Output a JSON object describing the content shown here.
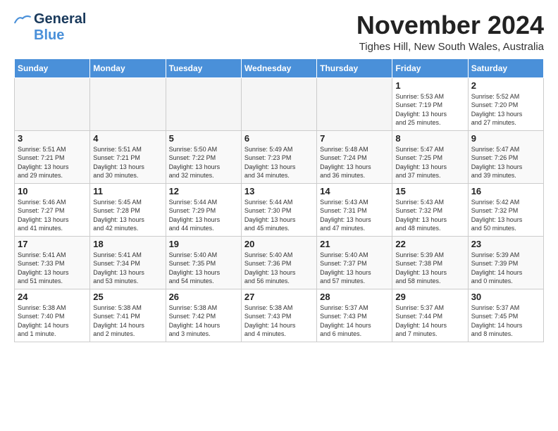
{
  "logo": {
    "line1": "General",
    "line2": "Blue"
  },
  "title": "November 2024",
  "location": "Tighes Hill, New South Wales, Australia",
  "days_of_week": [
    "Sunday",
    "Monday",
    "Tuesday",
    "Wednesday",
    "Thursday",
    "Friday",
    "Saturday"
  ],
  "weeks": [
    [
      {
        "day": "",
        "info": ""
      },
      {
        "day": "",
        "info": ""
      },
      {
        "day": "",
        "info": ""
      },
      {
        "day": "",
        "info": ""
      },
      {
        "day": "",
        "info": ""
      },
      {
        "day": "1",
        "info": "Sunrise: 5:53 AM\nSunset: 7:19 PM\nDaylight: 13 hours\nand 25 minutes."
      },
      {
        "day": "2",
        "info": "Sunrise: 5:52 AM\nSunset: 7:20 PM\nDaylight: 13 hours\nand 27 minutes."
      }
    ],
    [
      {
        "day": "3",
        "info": "Sunrise: 5:51 AM\nSunset: 7:21 PM\nDaylight: 13 hours\nand 29 minutes."
      },
      {
        "day": "4",
        "info": "Sunrise: 5:51 AM\nSunset: 7:21 PM\nDaylight: 13 hours\nand 30 minutes."
      },
      {
        "day": "5",
        "info": "Sunrise: 5:50 AM\nSunset: 7:22 PM\nDaylight: 13 hours\nand 32 minutes."
      },
      {
        "day": "6",
        "info": "Sunrise: 5:49 AM\nSunset: 7:23 PM\nDaylight: 13 hours\nand 34 minutes."
      },
      {
        "day": "7",
        "info": "Sunrise: 5:48 AM\nSunset: 7:24 PM\nDaylight: 13 hours\nand 36 minutes."
      },
      {
        "day": "8",
        "info": "Sunrise: 5:47 AM\nSunset: 7:25 PM\nDaylight: 13 hours\nand 37 minutes."
      },
      {
        "day": "9",
        "info": "Sunrise: 5:47 AM\nSunset: 7:26 PM\nDaylight: 13 hours\nand 39 minutes."
      }
    ],
    [
      {
        "day": "10",
        "info": "Sunrise: 5:46 AM\nSunset: 7:27 PM\nDaylight: 13 hours\nand 41 minutes."
      },
      {
        "day": "11",
        "info": "Sunrise: 5:45 AM\nSunset: 7:28 PM\nDaylight: 13 hours\nand 42 minutes."
      },
      {
        "day": "12",
        "info": "Sunrise: 5:44 AM\nSunset: 7:29 PM\nDaylight: 13 hours\nand 44 minutes."
      },
      {
        "day": "13",
        "info": "Sunrise: 5:44 AM\nSunset: 7:30 PM\nDaylight: 13 hours\nand 45 minutes."
      },
      {
        "day": "14",
        "info": "Sunrise: 5:43 AM\nSunset: 7:31 PM\nDaylight: 13 hours\nand 47 minutes."
      },
      {
        "day": "15",
        "info": "Sunrise: 5:43 AM\nSunset: 7:32 PM\nDaylight: 13 hours\nand 48 minutes."
      },
      {
        "day": "16",
        "info": "Sunrise: 5:42 AM\nSunset: 7:32 PM\nDaylight: 13 hours\nand 50 minutes."
      }
    ],
    [
      {
        "day": "17",
        "info": "Sunrise: 5:41 AM\nSunset: 7:33 PM\nDaylight: 13 hours\nand 51 minutes."
      },
      {
        "day": "18",
        "info": "Sunrise: 5:41 AM\nSunset: 7:34 PM\nDaylight: 13 hours\nand 53 minutes."
      },
      {
        "day": "19",
        "info": "Sunrise: 5:40 AM\nSunset: 7:35 PM\nDaylight: 13 hours\nand 54 minutes."
      },
      {
        "day": "20",
        "info": "Sunrise: 5:40 AM\nSunset: 7:36 PM\nDaylight: 13 hours\nand 56 minutes."
      },
      {
        "day": "21",
        "info": "Sunrise: 5:40 AM\nSunset: 7:37 PM\nDaylight: 13 hours\nand 57 minutes."
      },
      {
        "day": "22",
        "info": "Sunrise: 5:39 AM\nSunset: 7:38 PM\nDaylight: 13 hours\nand 58 minutes."
      },
      {
        "day": "23",
        "info": "Sunrise: 5:39 AM\nSunset: 7:39 PM\nDaylight: 14 hours\nand 0 minutes."
      }
    ],
    [
      {
        "day": "24",
        "info": "Sunrise: 5:38 AM\nSunset: 7:40 PM\nDaylight: 14 hours\nand 1 minute."
      },
      {
        "day": "25",
        "info": "Sunrise: 5:38 AM\nSunset: 7:41 PM\nDaylight: 14 hours\nand 2 minutes."
      },
      {
        "day": "26",
        "info": "Sunrise: 5:38 AM\nSunset: 7:42 PM\nDaylight: 14 hours\nand 3 minutes."
      },
      {
        "day": "27",
        "info": "Sunrise: 5:38 AM\nSunset: 7:43 PM\nDaylight: 14 hours\nand 4 minutes."
      },
      {
        "day": "28",
        "info": "Sunrise: 5:37 AM\nSunset: 7:43 PM\nDaylight: 14 hours\nand 6 minutes."
      },
      {
        "day": "29",
        "info": "Sunrise: 5:37 AM\nSunset: 7:44 PM\nDaylight: 14 hours\nand 7 minutes."
      },
      {
        "day": "30",
        "info": "Sunrise: 5:37 AM\nSunset: 7:45 PM\nDaylight: 14 hours\nand 8 minutes."
      }
    ]
  ]
}
